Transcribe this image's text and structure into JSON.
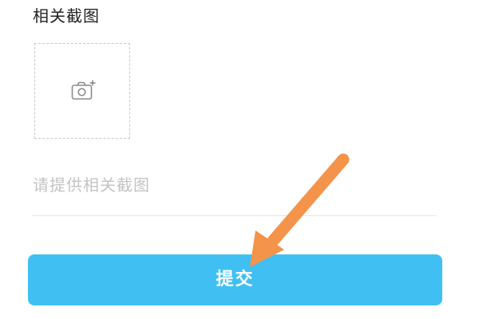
{
  "screenshot_section": {
    "title": "相关截图",
    "upload_icon": "camera-add-icon"
  },
  "description": {
    "value": "",
    "placeholder": "请提供相关截图"
  },
  "submit": {
    "label": "提交"
  },
  "annotation": {
    "arrow_color": "#f4934a"
  },
  "colors": {
    "accent": "#40c0f2",
    "placeholder": "#c4c4c4",
    "divider": "#e6e6e6"
  }
}
